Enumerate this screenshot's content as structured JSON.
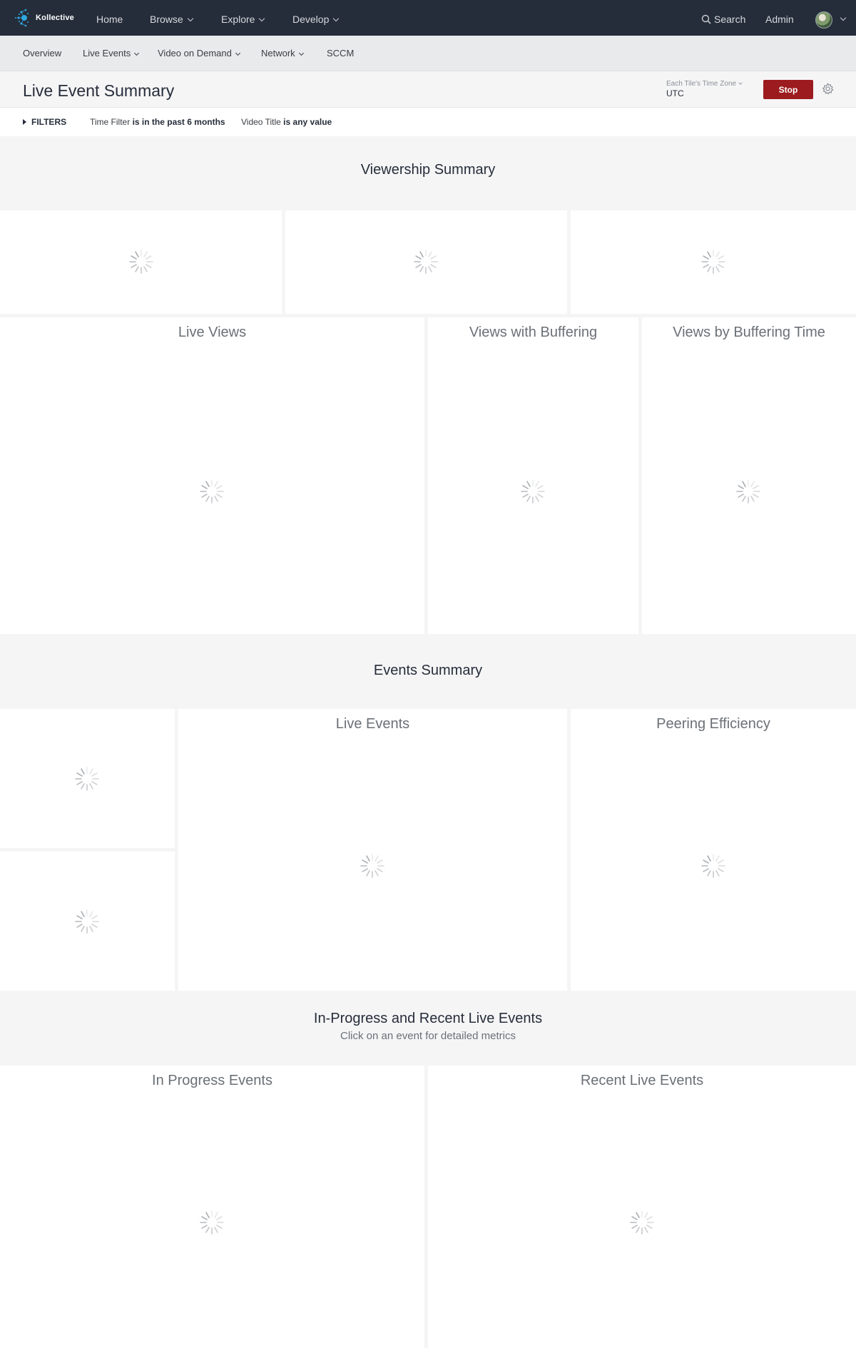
{
  "brand": {
    "name": "Kollective",
    "accent": "#2fa8e0"
  },
  "topnav": {
    "items": [
      {
        "label": "Home",
        "dropdown": false
      },
      {
        "label": "Browse",
        "dropdown": true
      },
      {
        "label": "Explore",
        "dropdown": true
      },
      {
        "label": "Develop",
        "dropdown": true
      }
    ],
    "search_label": "Search",
    "admin_label": "Admin"
  },
  "subnav": {
    "items": [
      {
        "label": "Overview",
        "dropdown": false
      },
      {
        "label": "Live Events",
        "dropdown": true
      },
      {
        "label": "Video on Demand",
        "dropdown": true
      },
      {
        "label": "Network",
        "dropdown": true
      },
      {
        "label": "SCCM",
        "dropdown": false
      }
    ]
  },
  "header": {
    "title": "Live Event Summary",
    "timezone_label": "Each Tile's Time Zone",
    "timezone_value": "UTC",
    "stop_label": "Stop",
    "stop_color": "#9c1b1f"
  },
  "filters": {
    "toggle_label": "FILTERS",
    "chips": [
      {
        "name": "Time Filter",
        "condition": "is in the past 6 months"
      },
      {
        "name": "Video Title",
        "condition": "is any value"
      }
    ]
  },
  "sections": {
    "viewership": {
      "title": "Viewership Summary"
    },
    "events": {
      "title": "Events Summary"
    },
    "recent": {
      "title": "In-Progress and Recent Live Events",
      "subtitle": "Click on an event for detailed metrics"
    }
  },
  "tiles": {
    "live_views": "Live Views",
    "views_with_buffering": "Views with Buffering",
    "views_by_buffering_time": "Views by Buffering Time",
    "live_events": "Live Events",
    "peering_efficiency": "Peering Efficiency",
    "in_progress_events": "In Progress Events",
    "recent_live_events": "Recent Live Events"
  },
  "icons": {
    "logo": "kollective-logo-icon",
    "search": "search-icon",
    "gear": "gear-icon",
    "loading": "loading-spinner-icon",
    "avatar": "user-avatar"
  }
}
